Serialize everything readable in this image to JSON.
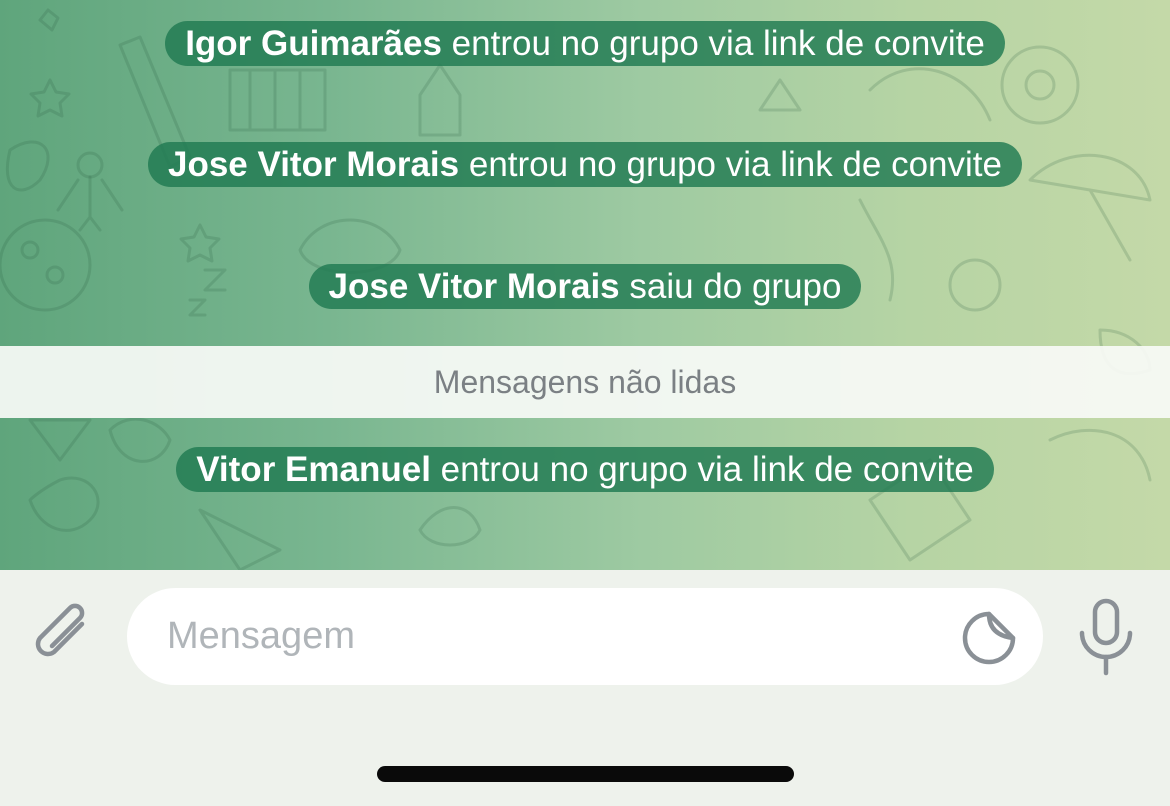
{
  "messages": [
    {
      "name": "Igor Guimarães",
      "text": " entrou no grupo via link de convite"
    },
    {
      "name": "Jose Vitor Morais",
      "text": " entrou no grupo via link de convite"
    },
    {
      "name": "Jose Vitor Morais",
      "text": " saiu do grupo"
    },
    {
      "name": "Vitor Emanuel",
      "text": " entrou no grupo via link de convite"
    }
  ],
  "unread_divider": {
    "label": "Mensagens não lidas"
  },
  "composer": {
    "placeholder": "Mensagem",
    "attach_icon": "paperclip-icon",
    "sticker_icon": "sticker-icon",
    "mic_icon": "microphone-icon"
  },
  "colors": {
    "service_pill": "#207a52",
    "icon_gray": "#8a9096",
    "composer_bg": "#eef2ec"
  }
}
